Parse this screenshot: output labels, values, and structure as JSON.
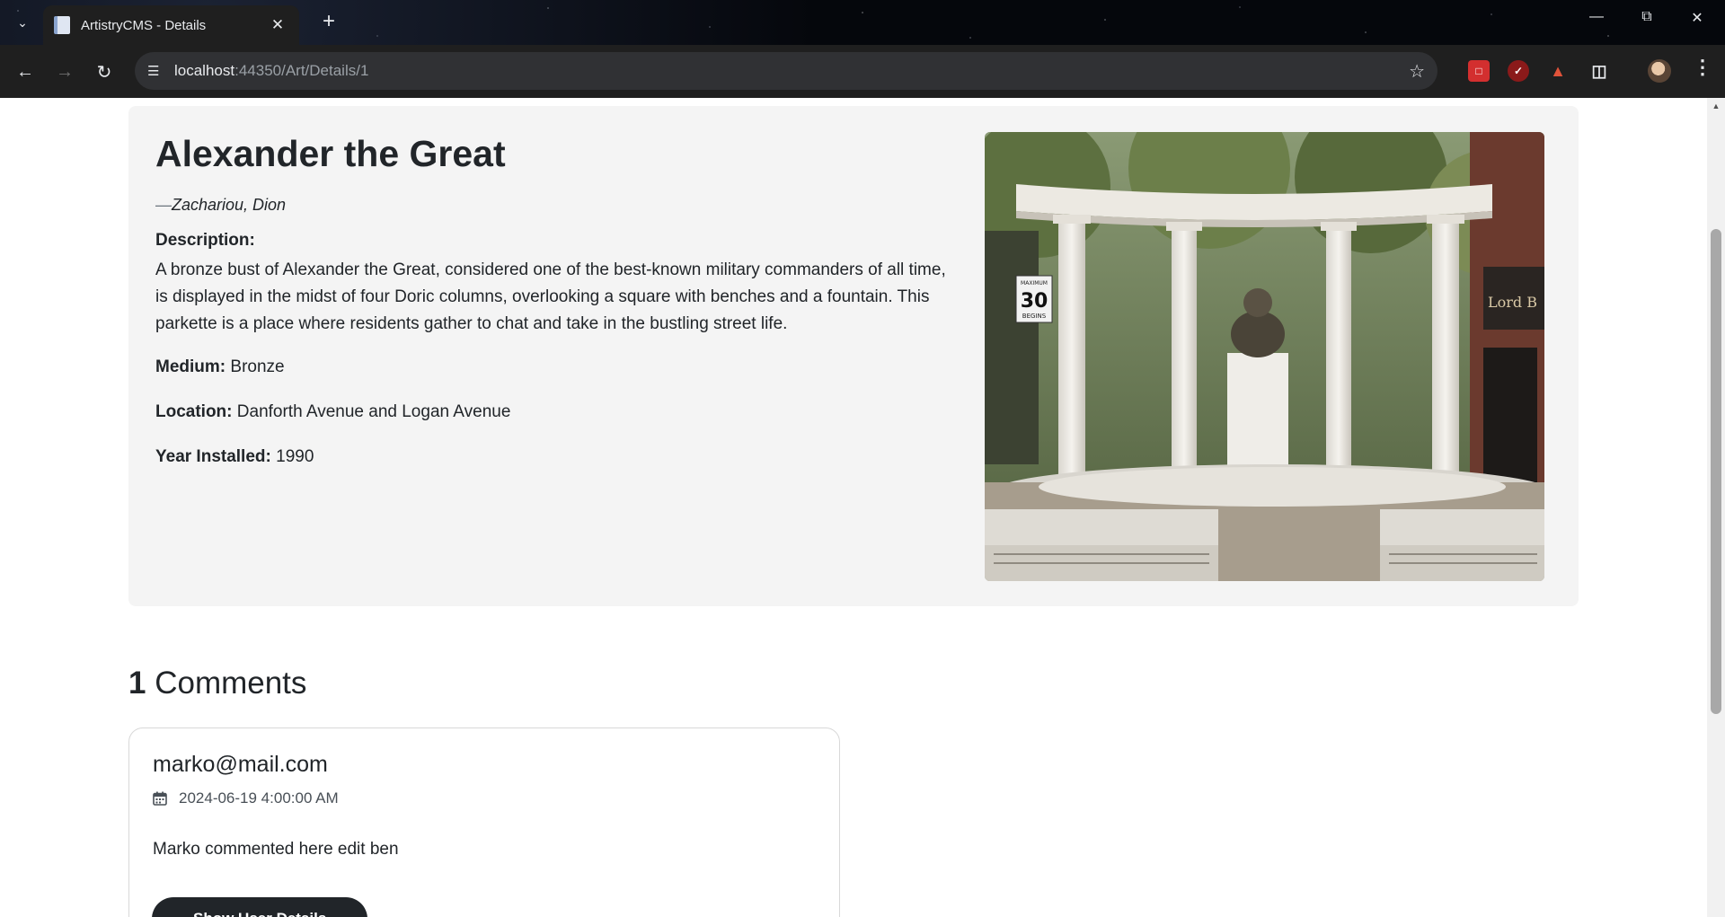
{
  "browser": {
    "tab_title": "ArtistryCMS - Details",
    "url_host": "localhost",
    "url_path": ":44350/Art/Details/1",
    "accent": "#1f1f1f"
  },
  "art": {
    "title": "Alexander the Great",
    "artist": "Zachariou, Dion",
    "description_label": "Description:",
    "description": "A bronze bust of Alexander the Great, considered one of the best-known military commanders of all time, is displayed in the midst of four Doric columns, overlooking a square with benches and a fountain. This parkette is a place where residents gather to chat and take in the bustling street life.",
    "medium_label": "Medium:",
    "medium": "Bronze",
    "location_label": "Location:",
    "location": "Danforth Avenue and Logan Avenue",
    "year_label": "Year Installed:",
    "year": "1990",
    "sign_top": "MAXIMUM",
    "sign_number": "30",
    "sign_bottom": "BEGINS",
    "storefront_text": "Lord B"
  },
  "comments": {
    "count": "1",
    "heading": "Comments",
    "items": [
      {
        "author": "marko@mail.com",
        "date": "2024-06-19 4:00:00 AM",
        "body": "Marko commented here edit ben",
        "button": "Show User Details"
      }
    ]
  }
}
